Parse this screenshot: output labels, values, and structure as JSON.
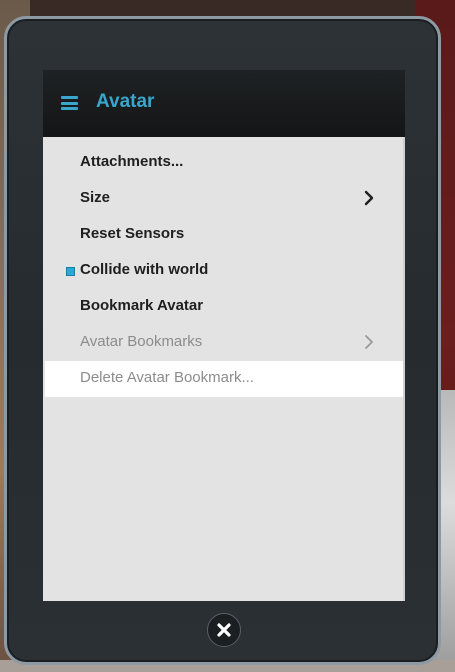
{
  "header": {
    "title": "Avatar",
    "menu_icon": "hamburger-menu-icon",
    "accent_color": "#3aa6cc"
  },
  "menu": {
    "items": [
      {
        "label": "Attachments...",
        "enabled": true,
        "submenu": false,
        "checked": false
      },
      {
        "label": "Size",
        "enabled": true,
        "submenu": true,
        "checked": false
      },
      {
        "label": "Reset Sensors",
        "enabled": true,
        "submenu": false,
        "checked": false
      },
      {
        "label": "Collide with world",
        "enabled": true,
        "submenu": false,
        "checked": true
      },
      {
        "label": "Bookmark Avatar",
        "enabled": true,
        "submenu": false,
        "checked": false
      },
      {
        "label": "Avatar Bookmarks",
        "enabled": false,
        "submenu": true,
        "checked": false
      },
      {
        "label": "Delete Avatar Bookmark...",
        "enabled": false,
        "submenu": false,
        "checked": false,
        "highlighted": true
      }
    ]
  },
  "footer": {
    "close_icon": "close-icon"
  }
}
